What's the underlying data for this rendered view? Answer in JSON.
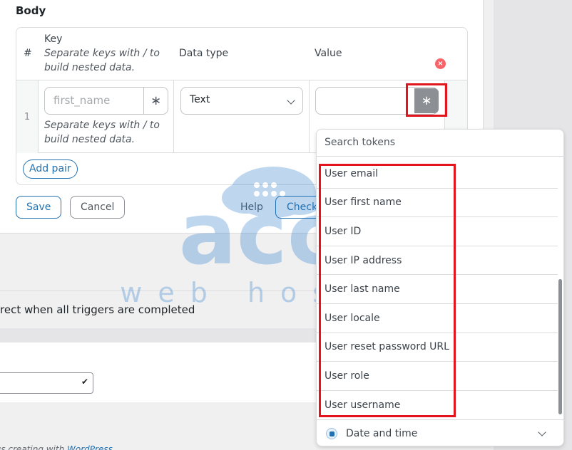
{
  "body_section": {
    "title": "Body",
    "columns": {
      "num": "#",
      "key": "Key",
      "key_hint": "Separate keys with / to build nested data.",
      "data_type": "Data type",
      "value": "Value"
    },
    "rows": [
      {
        "num": "1",
        "key_placeholder": "first_name",
        "key_hint": "Separate keys with / to build nested data.",
        "data_type": "Text",
        "value": ""
      }
    ],
    "add_pair_label": "Add pair",
    "token_button_glyph": "∗",
    "delete_glyph": "×"
  },
  "actions": {
    "save": "Save",
    "cancel": "Cancel",
    "help": "Help",
    "check": "Check"
  },
  "lower": {
    "redirect_text": "rect when all triggers are completed",
    "select_check": "✔",
    "footer_prefix": "ıs creating with ",
    "footer_link": "WordPress"
  },
  "token_dropdown": {
    "search_placeholder": "Search tokens",
    "tokens": [
      "User email",
      "User first name",
      "User ID",
      "User IP address",
      "User last name",
      "User locale",
      "User reset password URL",
      "User role",
      "User username"
    ],
    "group_label": "Date and time",
    "group_icon": "calendar-icon"
  },
  "watermark": {
    "brand": "accu",
    "sub": "web hosting"
  },
  "colors": {
    "accent": "#2271b1",
    "highlight": "#e2141c",
    "danger": "#f86368"
  }
}
